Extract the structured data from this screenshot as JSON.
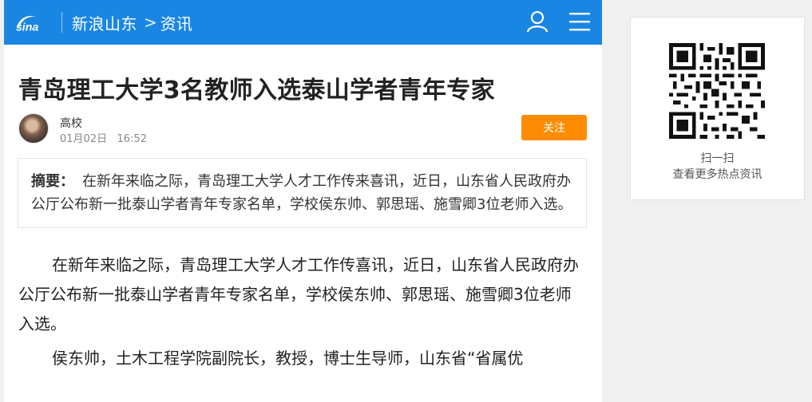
{
  "header": {
    "site_name": "新浪山东",
    "arrow": ">",
    "section": "资讯",
    "bg_color": "#1a86e4"
  },
  "article": {
    "title": "青岛理工大学3名教师入选泰山学者青年专家",
    "author": "高校",
    "date": "01月02日",
    "time": "16:52",
    "follow_label": "关注",
    "follow_color": "#ff8c00",
    "summary_label": "摘要：",
    "summary_text": "在新年来临之际，青岛理工大学人才工作传来喜讯，近日，山东省人民政府办公厅公布新一批泰山学者青年专家名单，学校侯东帅、郭思瑶、施雪卿3位老师入选。",
    "paragraphs": [
      "在新年来临之际，青岛理工大学人才工作传喜讯，近日，山东省人民政府办公厅公布新一批泰山学者青年专家名单，学校侯东帅、郭思瑶、施雪卿3位老师入选。",
      "侯东帅，土木工程学院副院长，教授，博士生导师，山东省“省属优"
    ]
  },
  "qr_card": {
    "line1": "扫一扫",
    "line2": "查看更多热点资讯"
  }
}
